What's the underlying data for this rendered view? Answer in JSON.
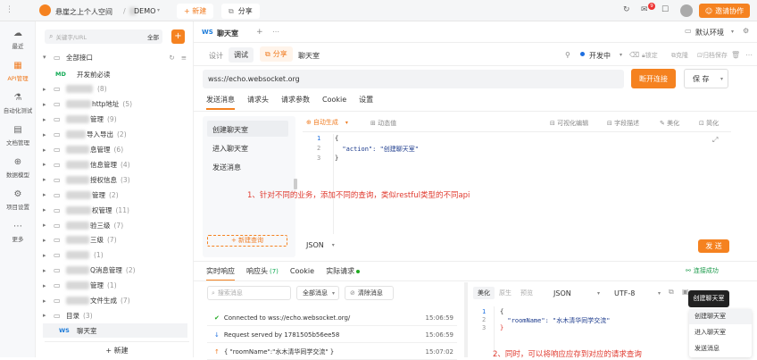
{
  "topbar": {
    "team": "悬崖之上个人空间",
    "sep": "/",
    "project": "DEMO",
    "new_label": "+ 新建",
    "share_label": "分享",
    "badge": "9",
    "invite_label": "邀请协作"
  },
  "rail": [
    {
      "icon": "cloud",
      "label": "最近"
    },
    {
      "icon": "api",
      "label": "API管理"
    },
    {
      "icon": "test",
      "label": "自动化测试"
    },
    {
      "icon": "doc",
      "label": "文档管理"
    },
    {
      "icon": "model",
      "label": "数据模型"
    },
    {
      "icon": "gear",
      "label": "项目设置"
    },
    {
      "icon": "more",
      "label": "更多"
    }
  ],
  "tree": {
    "search_placeholder": "关键字/URL",
    "filter": "全部",
    "root": "全部接口",
    "items": [
      {
        "tag": "MD",
        "label": "开发前必读"
      },
      {
        "label": "",
        "count": "(8)"
      },
      {
        "label": "http地址",
        "count": "(5)"
      },
      {
        "label": "管理",
        "count": "(9)"
      },
      {
        "label": "导入导出",
        "count": "(2)"
      },
      {
        "label": "息管理",
        "count": "(6)"
      },
      {
        "label": "信息管理",
        "count": "(4)"
      },
      {
        "label": "授权信息",
        "count": "(3)"
      },
      {
        "label": "管理",
        "count": "(2)"
      },
      {
        "label": "权管理",
        "count": "(11)"
      },
      {
        "label": "验三级",
        "count": "(7)"
      },
      {
        "label": "三级",
        "count": "(7)"
      },
      {
        "label": "",
        "count": "(1)"
      },
      {
        "label": "Q消息管理",
        "count": "(2)"
      },
      {
        "label": "管理",
        "count": "(1)"
      },
      {
        "label": "文件生成",
        "count": "(7)"
      },
      {
        "label": "目录",
        "count": "(3)"
      },
      {
        "tag": "WS",
        "label": "聊天室"
      }
    ],
    "new_button": "+ 新建"
  },
  "tabbar": {
    "tag": "WS",
    "tab": "聊天室",
    "env": "默认环境"
  },
  "modes": {
    "design": "设计",
    "debug": "调试",
    "share": "分享",
    "title": "聊天室",
    "status": "开发中",
    "lock": "锁定",
    "clone": "克隆",
    "archive": "归档保存"
  },
  "url": {
    "value": "wss://echo.websocket.org",
    "connect": "断开连接",
    "save": "保 存"
  },
  "req_tabs": [
    "发送消息",
    "请求头",
    "请求参数",
    "Cookie",
    "设置"
  ],
  "messages": [
    "创建聊天室",
    "进入聊天室",
    "发送消息"
  ],
  "editor": {
    "auto": "自动生成",
    "dynamic": "动态值",
    "visual": "可视化编辑",
    "field_desc": "字段描述",
    "beautify": "美化",
    "compress": "简化",
    "code_lines": [
      "{",
      "  \"action\": \"创建聊天室\"",
      "}"
    ],
    "format": "JSON",
    "send": "发 送"
  },
  "annotations": {
    "a1": "1、针对不同的业务，添加不同的查询，类似restful类型的不同api",
    "a2": "2、同时，可以将响应应存到对应的请求查询",
    "add_query": "+ 新建查询"
  },
  "resp_tabs": {
    "live": "实时响应",
    "headers": "响应头",
    "headers_count": "(7)",
    "cookie": "Cookie",
    "actual": "实际请求",
    "status": "连接成功"
  },
  "log": {
    "search_placeholder": "搜索消息",
    "filter": "全部消息",
    "clear": "清除消息",
    "rows": [
      {
        "text": "Connected to wss://echo.websocket.org/",
        "time": "15:06:59"
      },
      {
        "text": "Request served by 1781505b56ee58",
        "time": "15:06:59"
      },
      {
        "text": "{ \"roomName\":\"水木清华同学交流\" }",
        "time": "15:07:02"
      }
    ]
  },
  "resp_view": {
    "beautify": "美化",
    "raw": "原生",
    "preview": "预览",
    "format": "JSON",
    "encoding": "UTF-8",
    "code_lines": [
      "{",
      "  \"roomName\": \"水木清华同学交流\"",
      "}"
    ]
  },
  "popup": {
    "header": "创建聊天室",
    "items": [
      "创建聊天室",
      "进入聊天室",
      "发送消息"
    ]
  }
}
